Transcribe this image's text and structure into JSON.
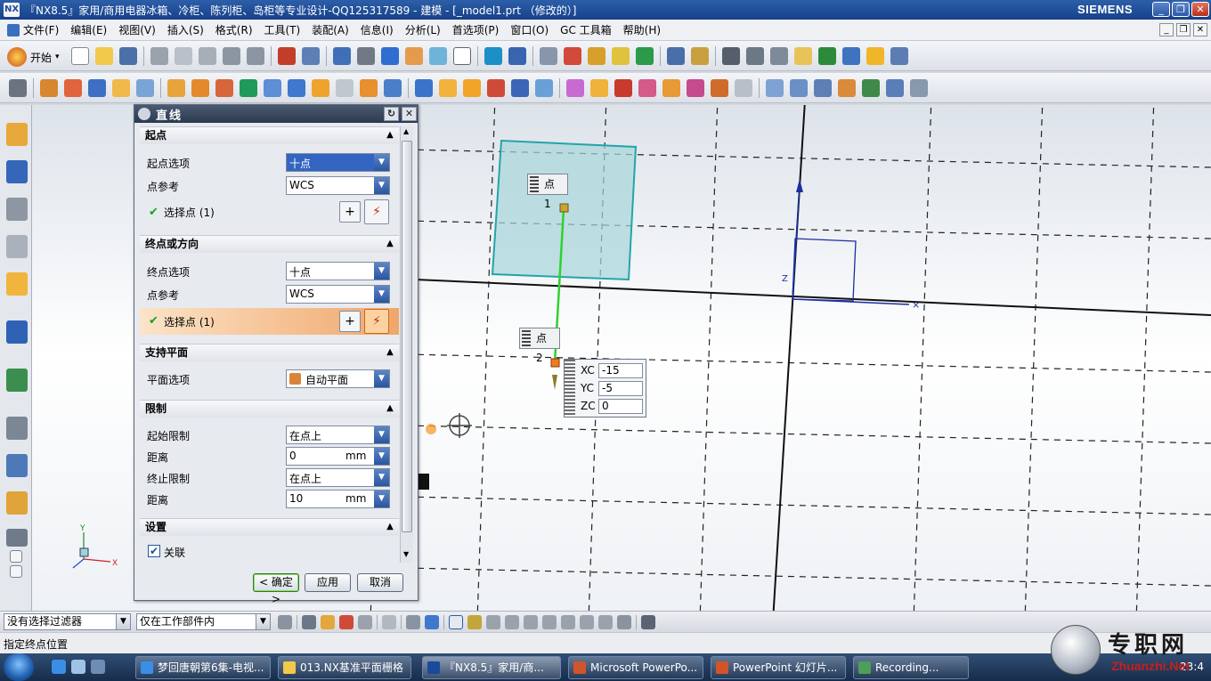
{
  "window": {
    "title": "『NX8.5』家用/商用电器冰箱、冷柜、陈列柜、岛柜等专业设计-QQ125317589 - 建模 - [_model1.prt （修改的）]",
    "brand": "SIEMENS",
    "controls": [
      "_",
      "❐",
      "✕"
    ]
  },
  "menu": {
    "items": [
      "文件(F)",
      "编辑(E)",
      "视图(V)",
      "插入(S)",
      "格式(R)",
      "工具(T)",
      "装配(A)",
      "信息(I)",
      "分析(L)",
      "首选项(P)",
      "窗口(O)",
      "GC 工具箱",
      "帮助(H)"
    ],
    "mdi_controls": [
      "_",
      "❐",
      "✕"
    ]
  },
  "toolbar": {
    "start_label": "开始"
  },
  "dialog": {
    "title": "直线",
    "sections": {
      "start": {
        "header": "起点",
        "option_label": "起点选项",
        "option_value": "十点",
        "ref_label": "点参考",
        "ref_value": "WCS",
        "select_label": "选择点 (1)"
      },
      "end": {
        "header": "终点或方向",
        "option_label": "终点选项",
        "option_value": "十点",
        "ref_label": "点参考",
        "ref_value": "WCS",
        "select_label": "选择点 (1)"
      },
      "plane": {
        "header": "支持平面",
        "option_label": "平面选项",
        "option_value": "自动平面"
      },
      "limits": {
        "header": "限制",
        "start_label": "起始限制",
        "start_value": "在点上",
        "dist1_label": "距离",
        "dist1_value": "0",
        "dist1_unit": "mm",
        "end_label": "终止限制",
        "end_value": "在点上",
        "dist2_label": "距离",
        "dist2_value": "10",
        "dist2_unit": "mm"
      },
      "settings": {
        "header": "设置",
        "assoc_label": "关联",
        "assoc_checked": true
      }
    },
    "buttons": {
      "ok": "< 确定 >",
      "apply": "应用",
      "cancel": "取消"
    }
  },
  "viewport": {
    "point1_label": "点 1",
    "point2_label": "点 2",
    "coords": {
      "xc_label": "XC",
      "xc_value": "-15",
      "yc_label": "YC",
      "yc_value": "-5",
      "zc_label": "ZC",
      "zc_value": "0"
    },
    "triad": {
      "x": "X",
      "y": "Y",
      "z": "Z"
    }
  },
  "selection_bar": {
    "filter": "没有选择过滤器",
    "scope": "仅在工作部件内"
  },
  "status": {
    "prompt": "指定终点位置"
  },
  "taskbar": {
    "tasks": [
      "梦回唐朝第6集-电视...",
      "013.NX基准平面栅格",
      "『NX8.5』家用/商...",
      "Microsoft PowerPo...",
      "PowerPoint 幻灯片...",
      "Recording..."
    ],
    "clock": "23:4"
  },
  "watermark": {
    "line1": "专职网",
    "line2": "Zhuanzhi.Net"
  },
  "colors": {
    "title_bar": "#1f4b94",
    "plane_fill": "#9fd3d6",
    "line": "#22cc22",
    "accent_orange": "#f28a3a"
  }
}
